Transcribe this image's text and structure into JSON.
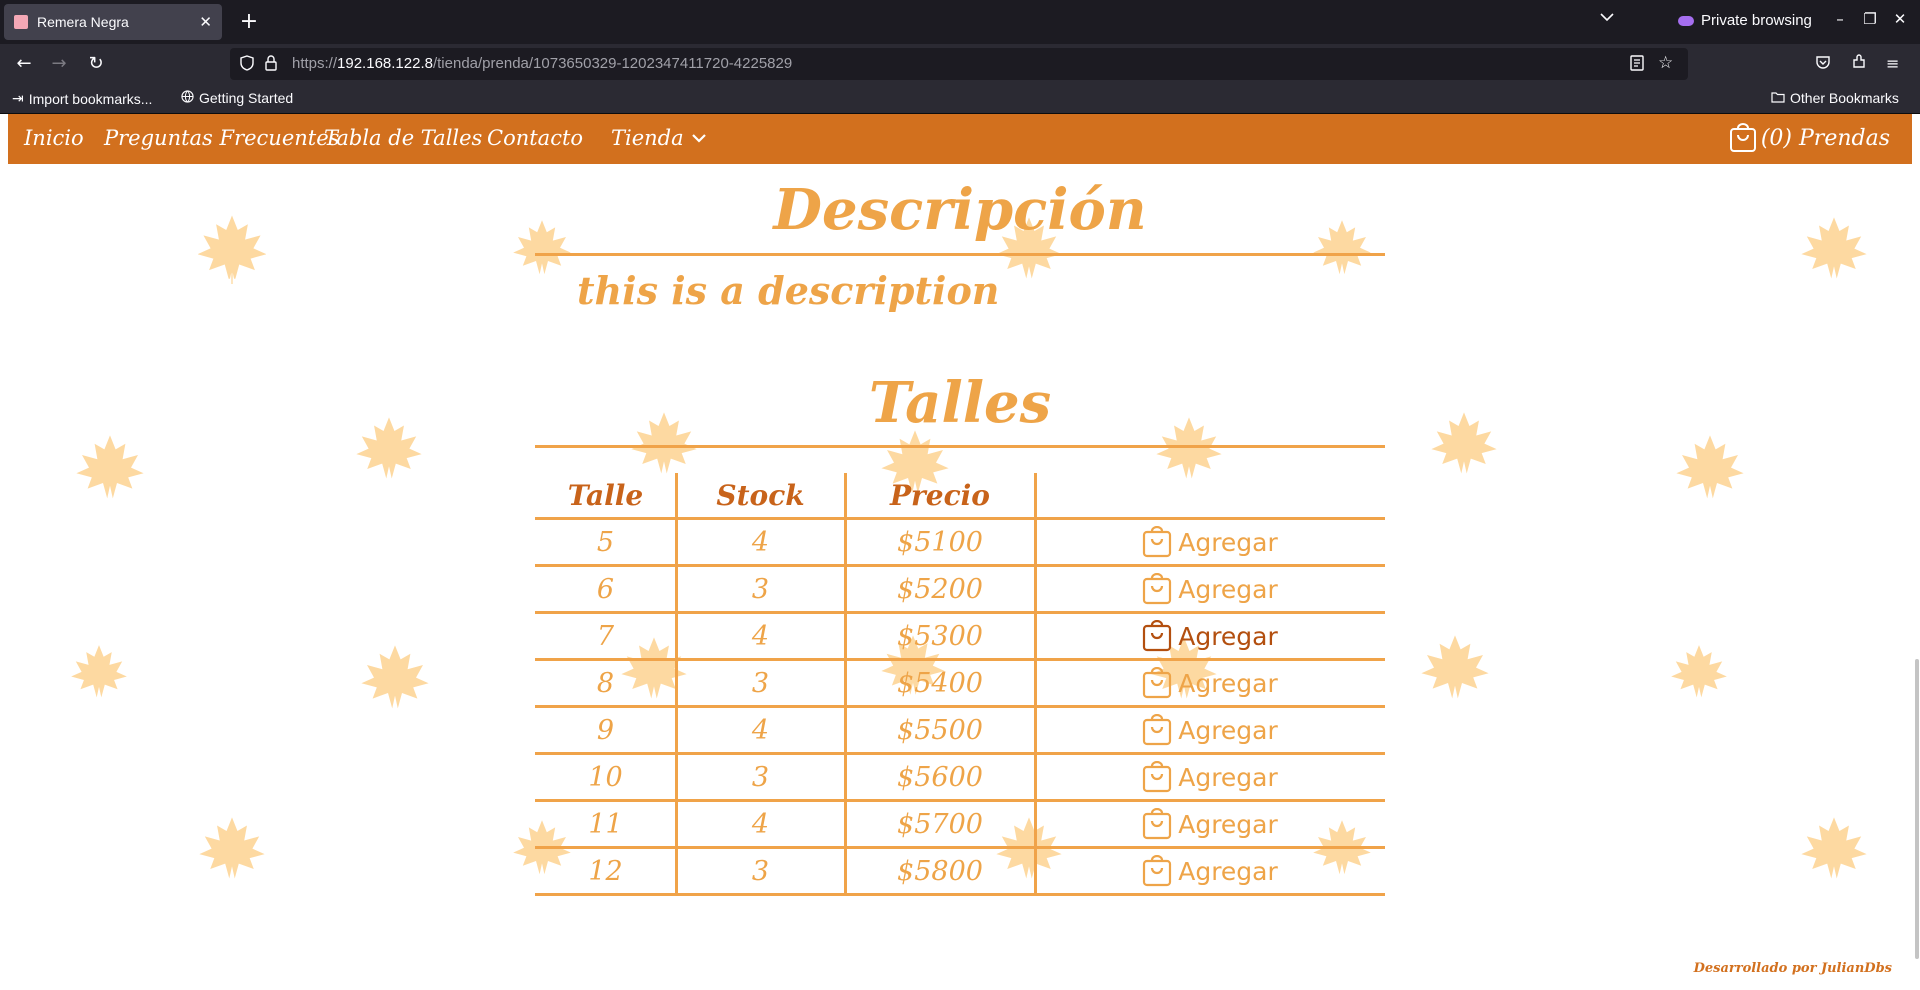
{
  "browser": {
    "tab_title": "Remera Negra",
    "private_label": "Private browsing",
    "url_prefix": "https://",
    "url_host": "192.168.122.8",
    "url_path": "/tienda/prenda/1073650329-1202347411720-4225829",
    "bookmarks": [
      "Import bookmarks...",
      "Getting Started"
    ],
    "other_bookmarks": "Other Bookmarks"
  },
  "site_nav": {
    "items": [
      "Inicio",
      "Preguntas Frecuentes",
      "Tabla de Talles",
      "Contacto",
      "Tienda"
    ],
    "cart_label": "(0) Prendas"
  },
  "description": {
    "heading": "Descripción",
    "text": "this is a description"
  },
  "talles": {
    "heading": "Talles",
    "columns": [
      "Talle",
      "Stock",
      "Precio"
    ],
    "add_label": "Agregar",
    "rows": [
      {
        "talle": "5",
        "stock": "4",
        "precio": "$5100"
      },
      {
        "talle": "6",
        "stock": "3",
        "precio": "$5200"
      },
      {
        "talle": "7",
        "stock": "4",
        "precio": "$5300"
      },
      {
        "talle": "8",
        "stock": "3",
        "precio": "$5400"
      },
      {
        "talle": "9",
        "stock": "4",
        "precio": "$5500"
      },
      {
        "talle": "10",
        "stock": "3",
        "precio": "$5600"
      },
      {
        "talle": "11",
        "stock": "4",
        "precio": "$5700"
      },
      {
        "talle": "12",
        "stock": "3",
        "precio": "$5800"
      }
    ]
  },
  "footer": {
    "credit": "Desarrollado por JulianDbs"
  },
  "colors": {
    "nav_orange": "#d2701e",
    "accent": "#eea448",
    "leaf": "#fdd08a"
  }
}
